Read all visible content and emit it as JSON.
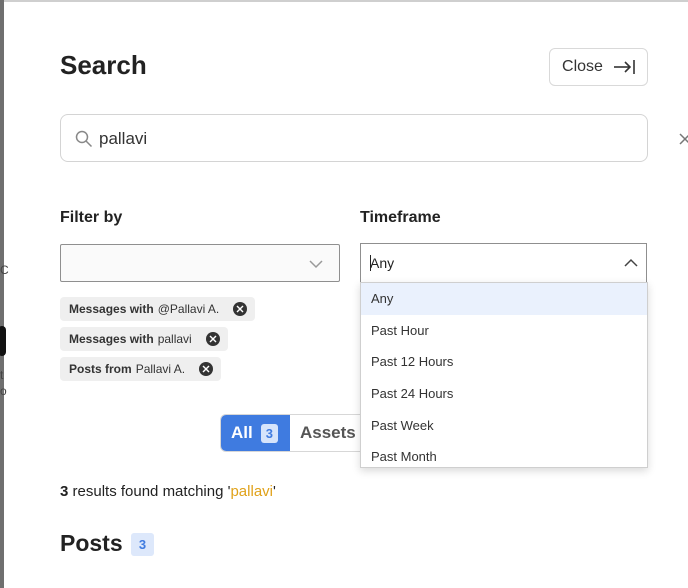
{
  "page": {
    "title": "Search",
    "close_label": "Close"
  },
  "search": {
    "value": "pallavi",
    "placeholder": ""
  },
  "filter": {
    "label": "Filter by",
    "selected": ""
  },
  "chips": [
    {
      "bold": "Messages with",
      "text": "@Pallavi A."
    },
    {
      "bold": "Messages with",
      "text": "pallavi"
    },
    {
      "bold": "Posts from",
      "text": "Pallavi A."
    }
  ],
  "timeframe": {
    "label": "Timeframe",
    "selected": "Any",
    "options": [
      "Any",
      "Past Hour",
      "Past 12 Hours",
      "Past 24 Hours",
      "Past Week",
      "Past Month"
    ]
  },
  "tabs": [
    {
      "label": "All",
      "count": "3",
      "active": true
    },
    {
      "label": "Assets",
      "active": false
    }
  ],
  "results": {
    "count": "3",
    "text": " results found matching '",
    "query": "pallavi",
    "suffix": "'"
  },
  "posts": {
    "title": "Posts",
    "count": "3"
  },
  "edge_fragments": [
    "C",
    "t",
    "o"
  ],
  "colors": {
    "accent": "#3f7be0",
    "query_highlight": "#e0a21a",
    "chip_bg": "#efefef"
  },
  "icons": [
    "close-arrow-icon",
    "search-icon",
    "clear-icon",
    "chevron-down-icon",
    "chevron-up-icon",
    "chip-remove-icon"
  ]
}
